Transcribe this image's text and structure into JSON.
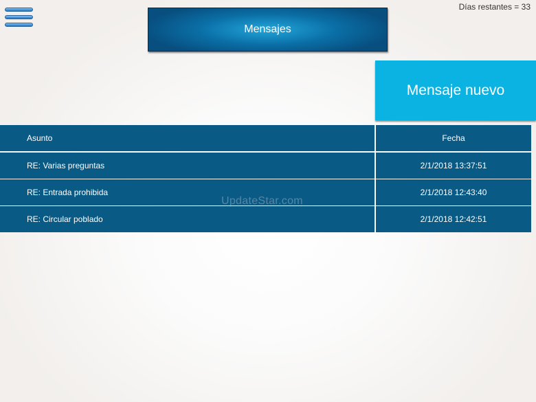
{
  "menu": {
    "icon": "hamburger-menu-icon"
  },
  "status": {
    "days_remaining": "Días restantes = 33"
  },
  "header": {
    "title": "Mensajes",
    "colors": {
      "title_bg_center": "#22a6db",
      "title_bg_edge": "#084f80"
    }
  },
  "actions": {
    "new_message_label": "Mensaje nuevo",
    "new_message_color": "#0bb3e3"
  },
  "table": {
    "header_color": "#0a5a86",
    "columns": {
      "subject": "Asunto",
      "date": "Fecha"
    },
    "rows": [
      {
        "subject": "RE: Varias preguntas",
        "date": "2/1/2018 13:37:51"
      },
      {
        "subject": "RE: Entrada prohibida",
        "date": "2/1/2018 12:43:40"
      },
      {
        "subject": "RE: Circular poblado",
        "date": "2/1/2018 12:42:51"
      }
    ]
  },
  "watermark": {
    "text": "UpdateStar.com"
  }
}
